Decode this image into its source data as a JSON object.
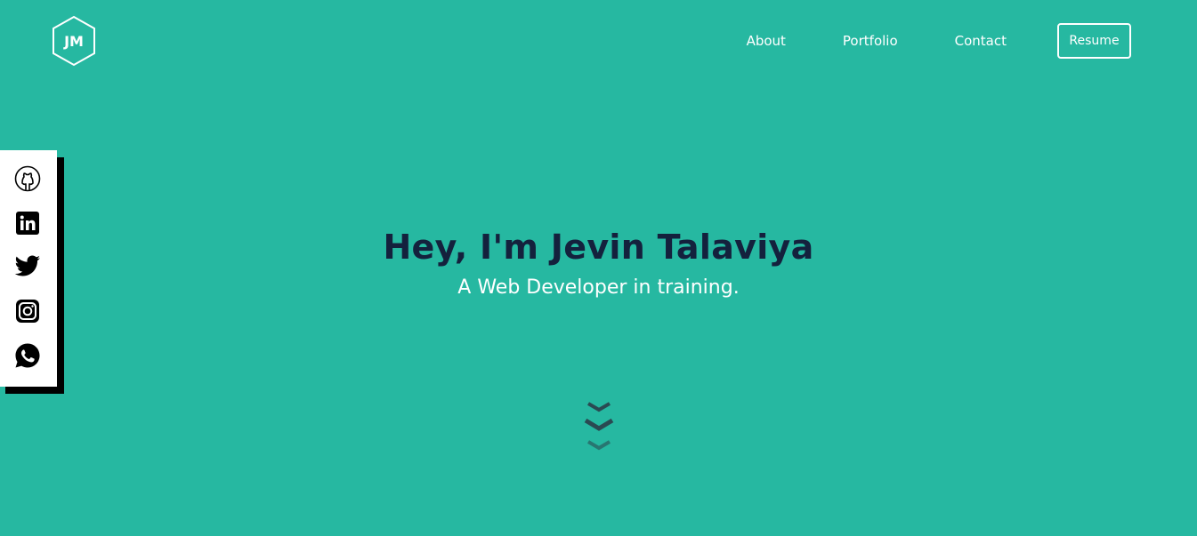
{
  "logo": {
    "text": "JM"
  },
  "nav": {
    "about": "About",
    "portfolio": "Portfolio",
    "contact": "Contact",
    "resume": "Resume"
  },
  "social": {
    "icons": [
      "github-icon",
      "linkedin-icon",
      "twitter-icon",
      "instagram-icon",
      "whatsapp-icon"
    ]
  },
  "hero": {
    "title": "Hey, I'm Jevin Talaviya",
    "subtitle": "A Web Developer in training."
  },
  "colors": {
    "background": "#26b8a1",
    "title": "#14213d",
    "text": "#ffffff",
    "arrow": "#2a4a52"
  }
}
